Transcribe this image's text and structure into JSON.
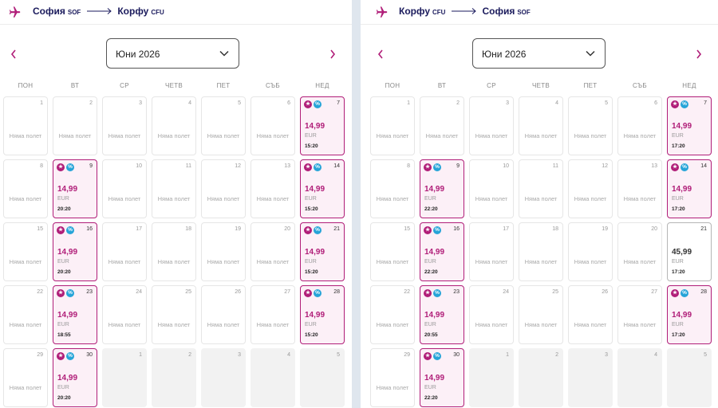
{
  "colors": {
    "brand": "#b01d78",
    "navy": "#1a1a5c",
    "badge_blue": "#26a4d8"
  },
  "icons": {
    "route": "plane-icon",
    "prev": "chevron-left-icon",
    "next": "chevron-right-icon",
    "dropdown": "chevron-down-icon",
    "badge1": "star-badge-icon",
    "badge2": "percent-badge-icon"
  },
  "weekdays": [
    "ПОН",
    "ВТ",
    "СР",
    "ЧЕТВ",
    "ПЕТ",
    "СЪБ",
    "НЕД"
  ],
  "no_flight_label": "Няма полет",
  "currency": "EUR",
  "panels": [
    {
      "route": {
        "from_city": "София",
        "from_code": "SOF",
        "to_city": "Корфу",
        "to_code": "CFU"
      },
      "month": "Юни 2026",
      "flights": [
        {
          "day": 7,
          "price": "14,99",
          "time": "15:20",
          "promo": true
        },
        {
          "day": 9,
          "price": "14,99",
          "time": "20:20",
          "promo": true
        },
        {
          "day": 14,
          "price": "14,99",
          "time": "15:20",
          "promo": true
        },
        {
          "day": 16,
          "price": "14,99",
          "time": "20:20",
          "promo": true
        },
        {
          "day": 21,
          "price": "14,99",
          "time": "15:20",
          "promo": true
        },
        {
          "day": 23,
          "price": "14,99",
          "time": "18:55",
          "promo": true
        },
        {
          "day": 28,
          "price": "14,99",
          "time": "15:20",
          "promo": true
        },
        {
          "day": 30,
          "price": "14,99",
          "time": "20:20",
          "promo": true
        }
      ]
    },
    {
      "route": {
        "from_city": "Корфу",
        "from_code": "CFU",
        "to_city": "София",
        "to_code": "SOF"
      },
      "month": "Юни 2026",
      "flights": [
        {
          "day": 7,
          "price": "14,99",
          "time": "17:20",
          "promo": true
        },
        {
          "day": 9,
          "price": "14,99",
          "time": "22:20",
          "promo": true
        },
        {
          "day": 14,
          "price": "14,99",
          "time": "17:20",
          "promo": true
        },
        {
          "day": 16,
          "price": "14,99",
          "time": "22:20",
          "promo": true
        },
        {
          "day": 21,
          "price": "45,99",
          "time": "17:20",
          "promo": false
        },
        {
          "day": 23,
          "price": "14,99",
          "time": "20:55",
          "promo": true
        },
        {
          "day": 28,
          "price": "14,99",
          "time": "17:20",
          "promo": true
        },
        {
          "day": 30,
          "price": "14,99",
          "time": "22:20",
          "promo": true
        }
      ]
    }
  ]
}
